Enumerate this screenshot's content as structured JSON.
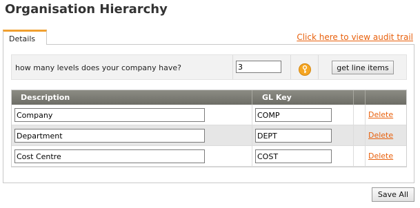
{
  "page": {
    "title": "Organisation Hierarchy"
  },
  "tabs": [
    {
      "label": "Details",
      "active": true
    }
  ],
  "audit_link": "Click here to view audit trail",
  "levels": {
    "question": "how many levels does your company have?",
    "value": "3",
    "help_icon": "key-help-icon",
    "button_label": "get line items"
  },
  "grid": {
    "headers": {
      "description": "Description",
      "gl_key": "GL Key"
    },
    "rows": [
      {
        "description": "Company",
        "gl_key": "COMP",
        "delete_label": "Delete"
      },
      {
        "description": "Department",
        "gl_key": "DEPT",
        "delete_label": "Delete"
      },
      {
        "description": "Cost Centre",
        "gl_key": "COST",
        "delete_label": "Delete"
      }
    ]
  },
  "save_label": "Save All",
  "colors": {
    "link": "#e8600c",
    "tab_accent": "#f0a030",
    "header_bg": "#7a7a72",
    "help_icon": "#f5a623"
  }
}
